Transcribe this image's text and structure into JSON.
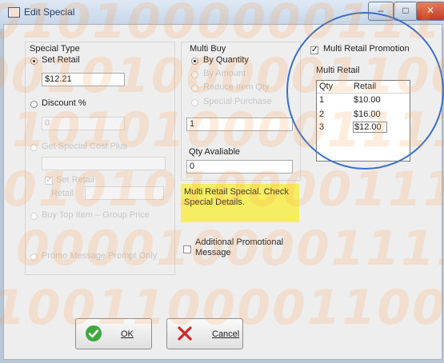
{
  "window": {
    "title": "Edit Special",
    "min": "–",
    "max": "□",
    "close": "✕"
  },
  "special_type": {
    "heading": "Special Type",
    "set_retail": {
      "label": "Set Retail",
      "selected": true,
      "value": "$12.21"
    },
    "discount": {
      "label": "Discount %",
      "selected": false,
      "value": "0"
    },
    "option3": {
      "label": "Get Special Cost Plus",
      "disabled": true
    },
    "retail_checkbox": {
      "label": "Set Retail",
      "disabled": true
    },
    "retail_field_label": "Retail",
    "option4": {
      "label": "Buy Top Item – Group Price",
      "disabled": true
    },
    "option5": {
      "label": "Promo Message Prompt Only",
      "disabled": true
    }
  },
  "multi_buy": {
    "heading": "Multi Buy",
    "by_quantity": {
      "label": "By Quantity",
      "selected": true
    },
    "opt2": {
      "label": "By Amount",
      "disabled": true
    },
    "opt3": {
      "label": "Reduce Item Qty",
      "disabled": true
    },
    "opt4": {
      "label": "Special Purchase",
      "disabled": true
    },
    "quantity_value": "1",
    "qty_available_label": "Qty Avaliable",
    "qty_available_value": "0",
    "note": "Multi Retail Special. Check Special Details.",
    "additional_label": "Additional Promotional Message"
  },
  "multi_retail": {
    "checkbox_label": "Multi Retail Promotion",
    "checked": true,
    "section_label": "Multi Retail",
    "columns": [
      "Qty",
      "Retail"
    ],
    "rows": [
      {
        "qty": "1",
        "retail": "$10.00"
      },
      {
        "qty": "2",
        "retail": "$16.00"
      },
      {
        "qty": "3",
        "retail": "$12.00"
      }
    ]
  },
  "buttons": {
    "ok": "OK",
    "cancel": "Cancel"
  },
  "watermark": [
    "0101000000111",
    "00101000001100",
    "1010100001111",
    "00101010000111",
    "0000100001111",
    "1001100001100"
  ],
  "colors": {
    "highlight": "#f6ee62",
    "circle": "#3b6fc4",
    "ok_icon": "#3fa83f",
    "cancel_icon": "#d9232a"
  }
}
